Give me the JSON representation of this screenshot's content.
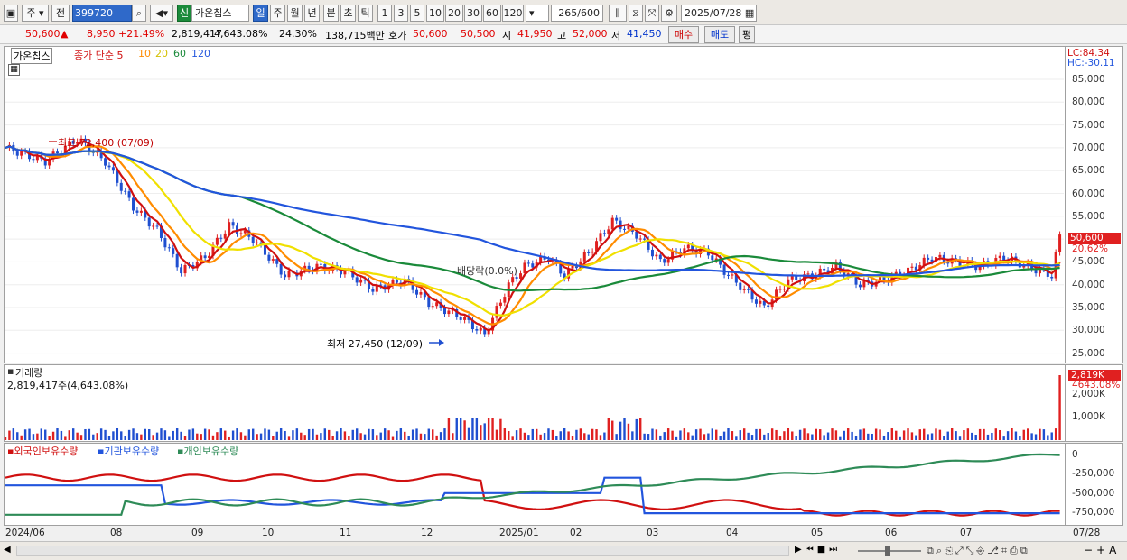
{
  "toolbar": {
    "market": "주",
    "prev": "전",
    "code": "399720",
    "badge": "신",
    "name": "가온칩스",
    "periods": [
      "일",
      "주",
      "월",
      "년",
      "분",
      "초",
      "틱"
    ],
    "active_period": "일",
    "counts": [
      "1",
      "3",
      "5",
      "10",
      "20",
      "30",
      "60",
      "120"
    ],
    "range": "265/600",
    "date": "2025/07/28"
  },
  "quote": {
    "price": "50,600",
    "arrow": "▲",
    "change": "8,950",
    "change_pct": "+21.49%",
    "volume": "2,819,417",
    "vol_ratio": "4,643.08%",
    "turnover": "24.30%",
    "amount": "138,715백만",
    "hoga_label": "호가",
    "ask": "50,600",
    "bid": "50,500",
    "open_label": "시",
    "open": "41,950",
    "high_label": "고",
    "high": "52,000",
    "low_label": "저",
    "low": "41,450",
    "buy_btn": "매수",
    "sell_btn": "매도",
    "eval_btn": "평"
  },
  "price_pane": {
    "stock_label": "가온칩스",
    "ma_legend": [
      "종가 단순 5",
      "10",
      "20",
      "60",
      "120"
    ],
    "ma_colors": [
      "#d01010",
      "#ff8c00",
      "#f0e000",
      "#1a8a3a",
      "#2255dd"
    ],
    "lc": "LC:84.34",
    "hc": "HC:-30.11",
    "y_ticks": [
      "85,000",
      "80,000",
      "75,000",
      "70,000",
      "65,000",
      "60,000",
      "55,000",
      "50,000",
      "45,000",
      "40,000",
      "35,000",
      "30,000",
      "25,000"
    ],
    "current_tag": "50,600",
    "current_pct": "20.62%",
    "high_annot": "최고 72,400 (07/09)",
    "low_annot": "최저 27,450 (12/09)",
    "event_annot": "배당락(0.0%)"
  },
  "volume_pane": {
    "title": "거래량",
    "value": "2,819,417주(4,643.08%)",
    "y_ticks": [
      "2,000K",
      "1,000K"
    ],
    "tag": "2,819K",
    "tag_pct": "4643.08%"
  },
  "holding_pane": {
    "legend": [
      "외국인보유수량",
      "기관보유수량",
      "개인보유수량"
    ],
    "colors": [
      "#d01010",
      "#2255dd",
      "#2e8b57"
    ],
    "y_ticks": [
      "0",
      "-250,000",
      "-500,000",
      "-750,000"
    ]
  },
  "x_axis": [
    "2024/06",
    "08",
    "09",
    "10",
    "11",
    "12",
    "2025/01",
    "02",
    "03",
    "04",
    "05",
    "06",
    "07",
    "07/28"
  ]
}
